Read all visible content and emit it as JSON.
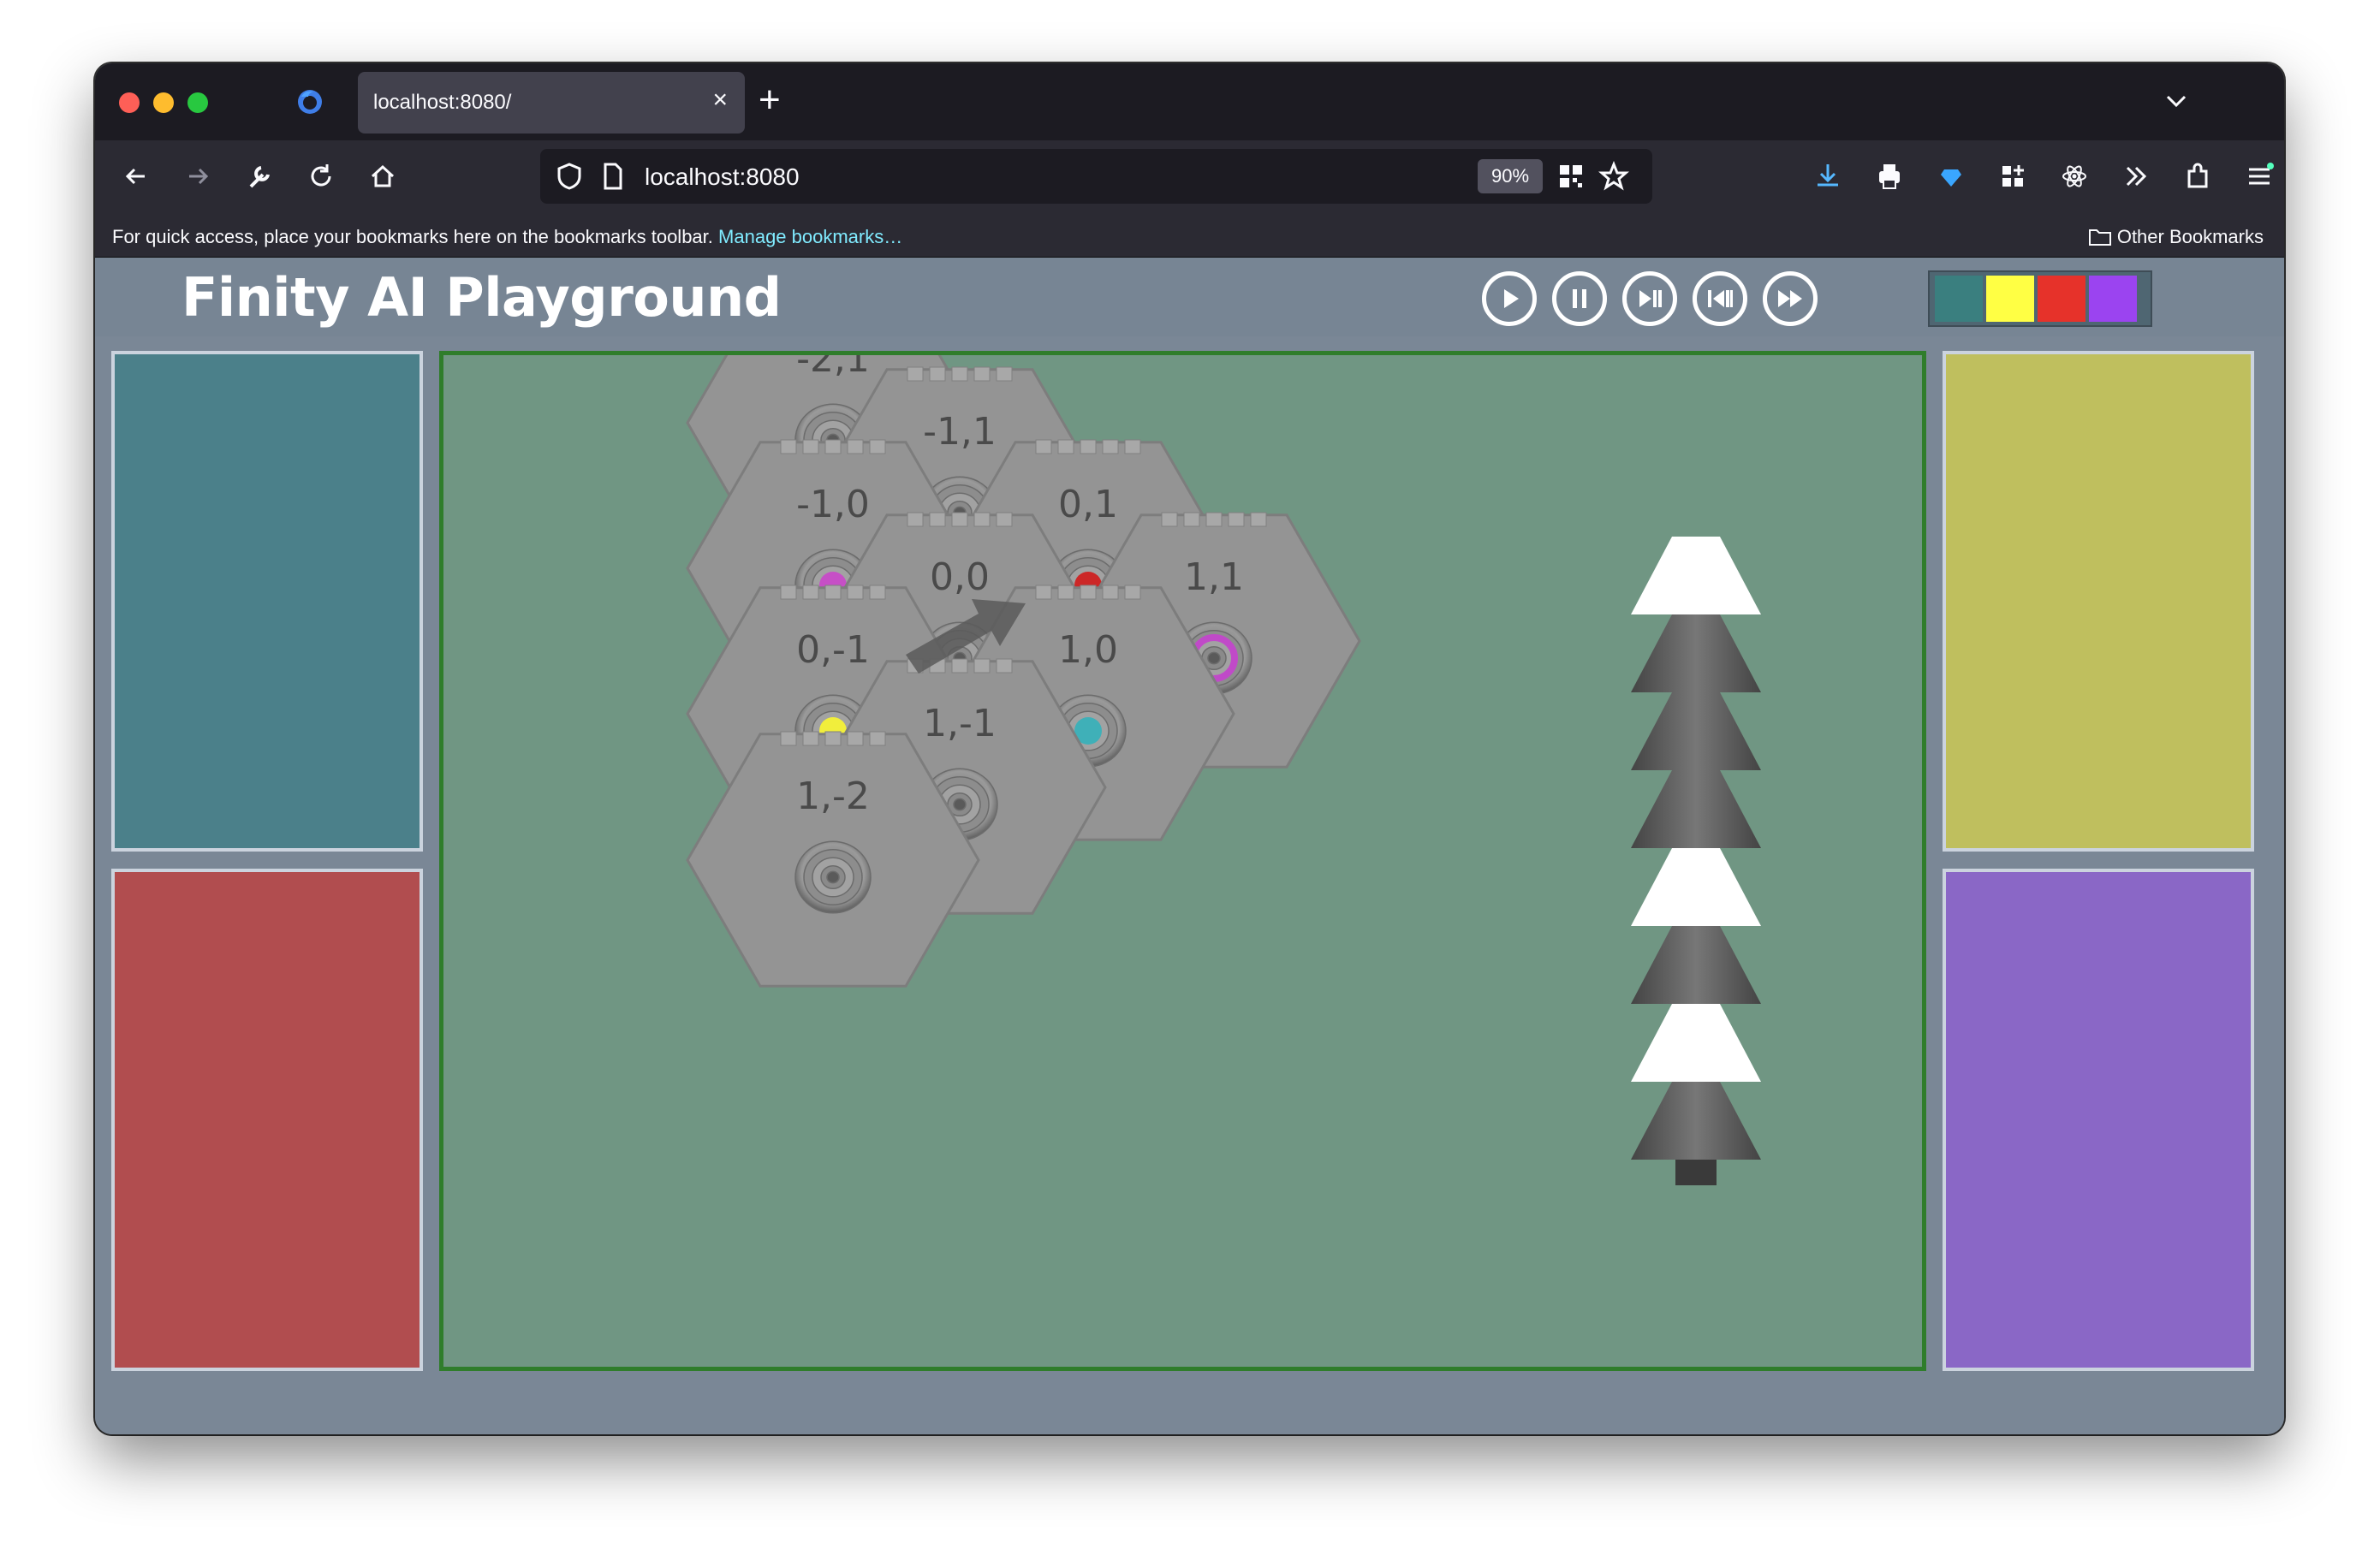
{
  "browser": {
    "tab_title": "localhost:8080/",
    "url": "localhost:8080",
    "zoom": "90%",
    "bookmarks_prompt": "For quick access, place your bookmarks here on the bookmarks toolbar.",
    "bookmarks_link": "Manage bookmarks…",
    "other_bookmarks": "Other Bookmarks"
  },
  "app": {
    "title": "Finity AI Playground",
    "controls": [
      "play-icon",
      "pause-icon",
      "step-forward-icon",
      "step-back-icon",
      "fast-forward-icon"
    ],
    "swatches": [
      "#3a7f7f",
      "#ffff44",
      "#e6322a",
      "#9b44f0"
    ]
  },
  "panels": {
    "top_left_color": "#4b808a",
    "bottom_left_color": "#b14d4f",
    "top_right_color": "#bfbf5e",
    "bottom_right_color": "#8a67c6"
  },
  "board": {
    "tiles": [
      {
        "label": "-2,1",
        "marker": null
      },
      {
        "label": "-1,1",
        "marker": null
      },
      {
        "label": "-1,0",
        "marker": "#c64fc6"
      },
      {
        "label": "0,1",
        "marker": "#cc2727"
      },
      {
        "label": "0,0",
        "marker": null
      },
      {
        "label": "1,1",
        "marker": "ring-#c04ac8"
      },
      {
        "label": "0,-1",
        "marker": "#f1ee3c"
      },
      {
        "label": "1,0",
        "marker": "#3fb0b8"
      },
      {
        "label": "1,-1",
        "marker": null
      },
      {
        "label": "1,-2",
        "marker": null
      }
    ],
    "stack": [
      "white",
      "gray",
      "gray",
      "gray",
      "white",
      "gray",
      "white",
      "gray"
    ]
  }
}
